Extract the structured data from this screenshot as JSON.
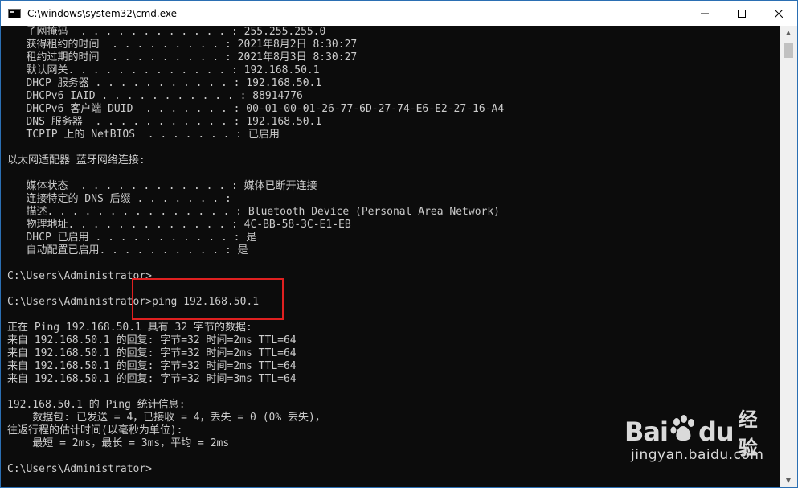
{
  "window": {
    "title": "C:\\windows\\system32\\cmd.exe",
    "icon": "cmd-icon",
    "controls": {
      "minimize": "minimize-icon",
      "maximize": "maximize-icon",
      "close": "close-icon"
    }
  },
  "console": {
    "lines": [
      "   子网掩码  . . . . . . . . . . . . : 255.255.255.0",
      "   获得租约的时间  . . . . . . . . . : 2021年8月2日 8:30:27",
      "   租约过期的时间  . . . . . . . . . : 2021年8月3日 8:30:27",
      "   默认网关. . . . . . . . . . . . . : 192.168.50.1",
      "   DHCP 服务器 . . . . . . . . . . . : 192.168.50.1",
      "   DHCPv6 IAID . . . . . . . . . . . : 88914776",
      "   DHCPv6 客户端 DUID  . . . . . . . : 00-01-00-01-26-77-6D-27-74-E6-E2-27-16-A4",
      "   DNS 服务器  . . . . . . . . . . . : 192.168.50.1",
      "   TCPIP 上的 NetBIOS  . . . . . . . : 已启用",
      "",
      "以太网适配器 蓝牙网络连接:",
      "",
      "   媒体状态  . . . . . . . . . . . . : 媒体已断开连接",
      "   连接特定的 DNS 后缀 . . . . . . . :",
      "   描述. . . . . . . . . . . . . . . : Bluetooth Device (Personal Area Network)",
      "   物理地址. . . . . . . . . . . . . : 4C-BB-58-3C-E1-EB",
      "   DHCP 已启用 . . . . . . . . . . . : 是",
      "   自动配置已启用. . . . . . . . . . : 是",
      "",
      "C:\\Users\\Administrator>",
      "",
      "C:\\Users\\Administrator>ping 192.168.50.1",
      "",
      "正在 Ping 192.168.50.1 具有 32 字节的数据:",
      "来自 192.168.50.1 的回复: 字节=32 时间=2ms TTL=64",
      "来自 192.168.50.1 的回复: 字节=32 时间=2ms TTL=64",
      "来自 192.168.50.1 的回复: 字节=32 时间=2ms TTL=64",
      "来自 192.168.50.1 的回复: 字节=32 时间=3ms TTL=64",
      "",
      "192.168.50.1 的 Ping 统计信息:",
      "    数据包: 已发送 = 4，已接收 = 4，丢失 = 0 (0% 丢失)，",
      "往返行程的估计时间(以毫秒为单位):",
      "    最短 = 2ms，最长 = 3ms，平均 = 2ms",
      "",
      "C:\\Users\\Administrator>"
    ]
  },
  "scrollbar": {
    "up_icon": "scroll-up-icon",
    "down_icon": "scroll-down-icon"
  },
  "watermark": {
    "logo_left": "Bai",
    "logo_right": "du",
    "logo_cn": "经验",
    "url": "jingyan.baidu.com"
  },
  "colors": {
    "console_bg": "#0c0c0c",
    "console_fg": "#cccccc",
    "highlight": "#e02020",
    "titlebar_bg": "#ffffff"
  }
}
